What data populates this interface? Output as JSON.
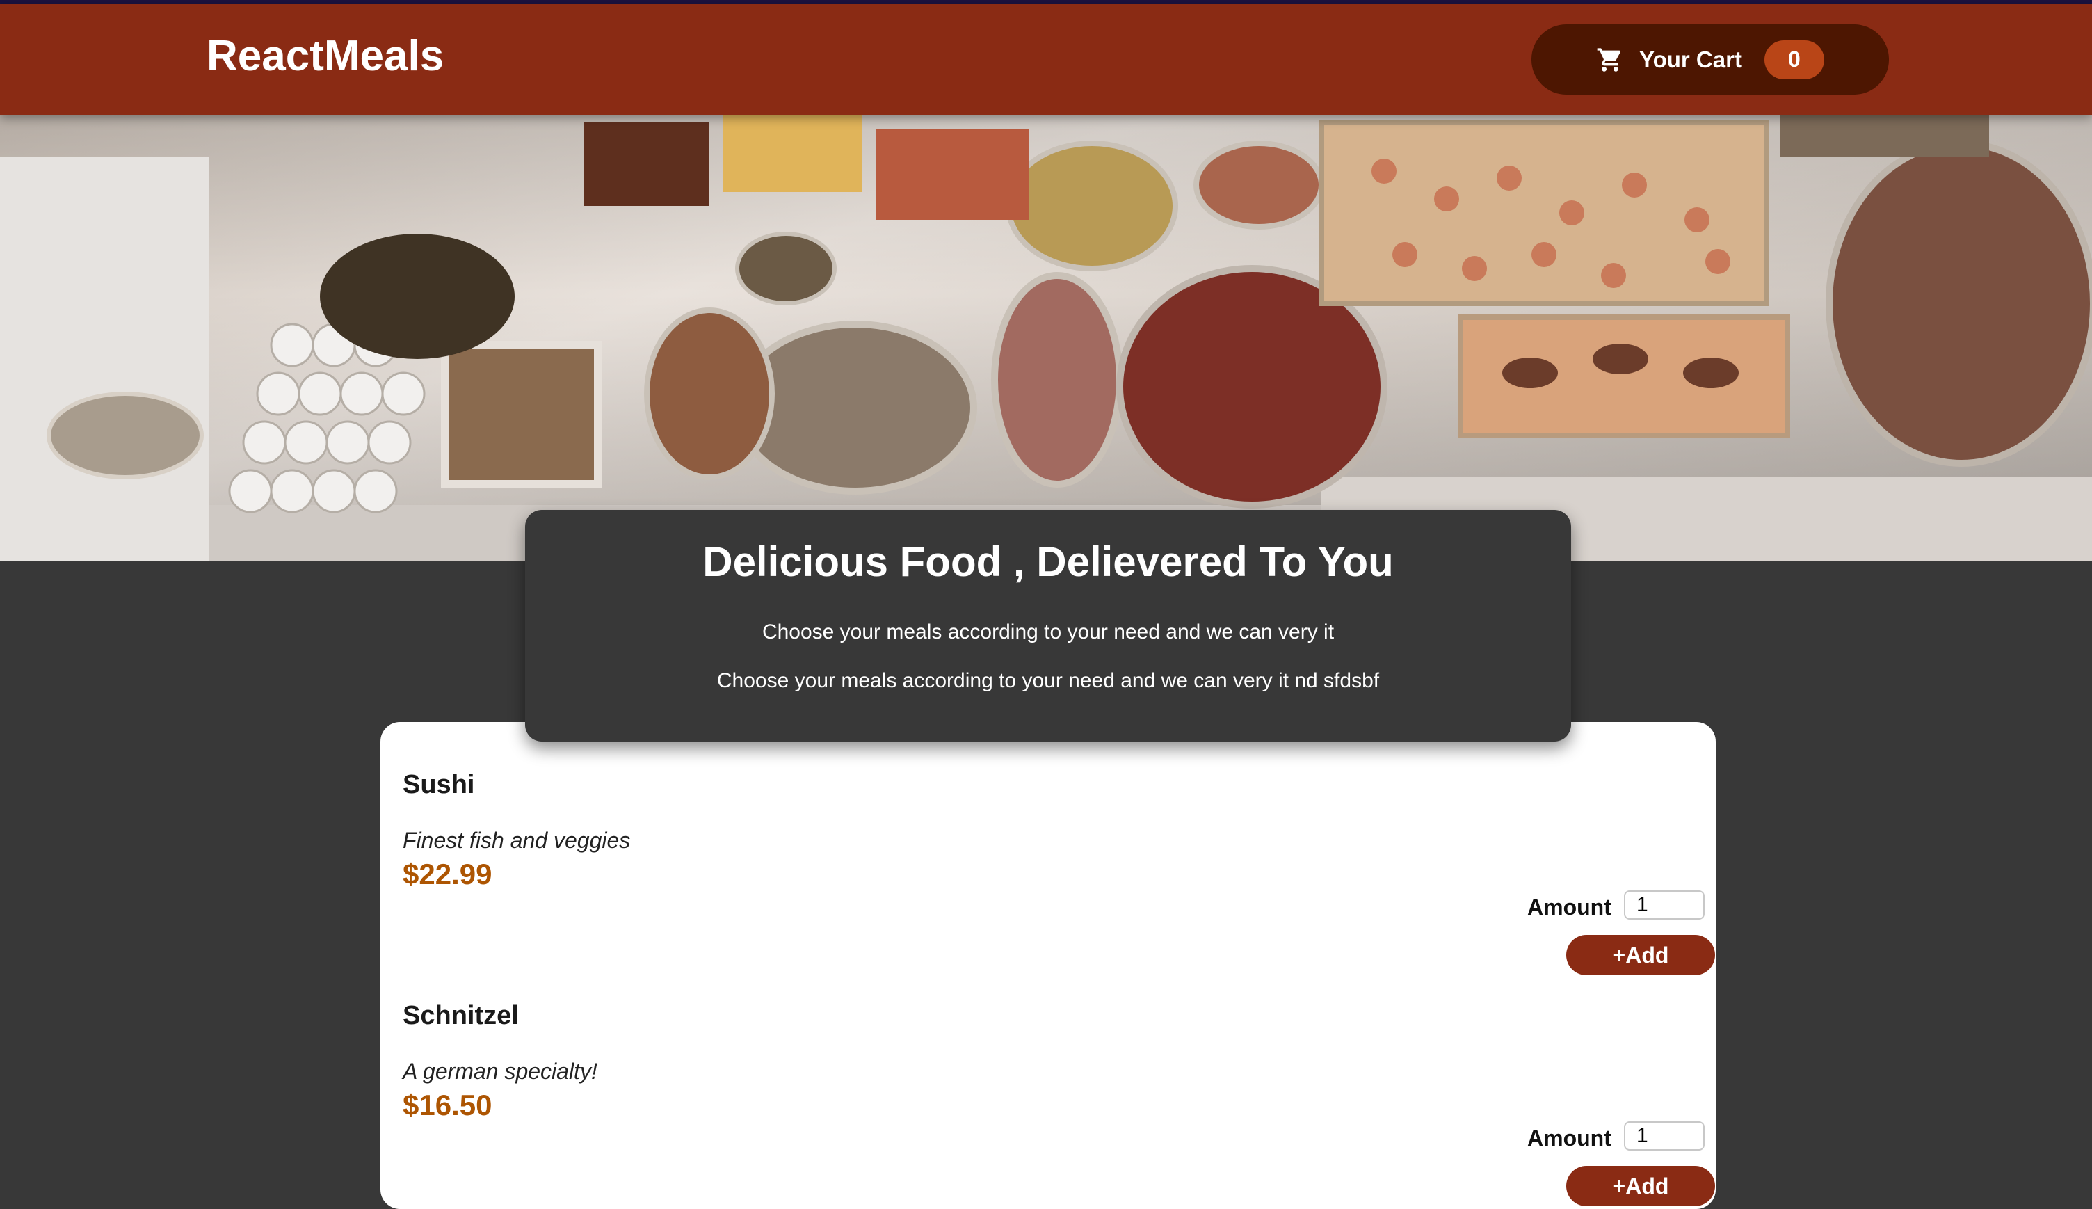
{
  "header": {
    "logo": "ReactMeals",
    "cart": {
      "icon": "cart-icon",
      "label": "Your Cart",
      "count": "0"
    }
  },
  "hero": {
    "image": "buffet table with many platters of food"
  },
  "summary": {
    "title": "Delicious Food , Delievered To You",
    "line1": "Choose your meals according to your need and we can very it",
    "line2": "Choose your meals according to your need and we can very it nd sfdsbf"
  },
  "meals": [
    {
      "name": "Sushi",
      "description": "Finest fish and veggies",
      "price": "$22.99",
      "amount_label": "Amount",
      "amount_value": "1",
      "add_label": "+Add"
    },
    {
      "name": "Schnitzel",
      "description": "A german specialty!",
      "price": "$16.50",
      "amount_label": "Amount",
      "amount_value": "1",
      "add_label": "+Add"
    }
  ],
  "colors": {
    "header": "#8a2b14",
    "cart_button": "#4d1601",
    "badge": "#b94517",
    "background": "#383838",
    "price": "#ad5502"
  }
}
